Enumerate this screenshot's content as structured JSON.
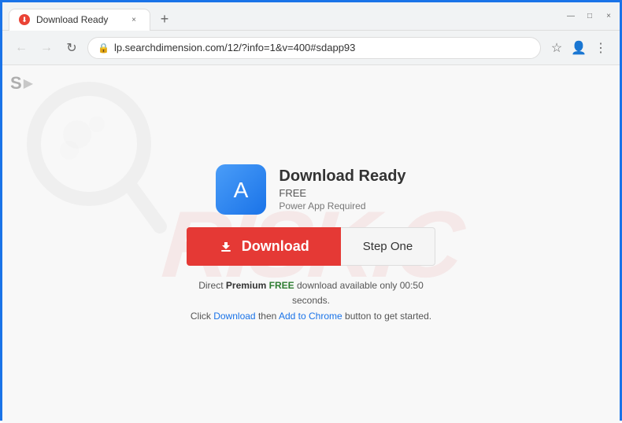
{
  "browser": {
    "tab": {
      "favicon": "🔴",
      "title": "Download Ready",
      "close_label": "×"
    },
    "new_tab_label": "+",
    "window_controls": {
      "minimize": "—",
      "maximize": "□",
      "close": "×"
    },
    "nav": {
      "back_label": "←",
      "forward_label": "→",
      "refresh_label": "↻"
    },
    "address_bar": {
      "lock_icon": "🔒",
      "url": "lp.searchdimension.com/12/?info=1&v=400#sdapp93"
    },
    "actions": {
      "bookmark_label": "☆",
      "account_label": "👤",
      "menu_label": "⋮"
    }
  },
  "page": {
    "logo": {
      "s": "S",
      "arrow": "▶"
    },
    "watermark": "RISK.C",
    "app": {
      "name": "Download Ready",
      "price": "FREE",
      "requirement": "Power App Required"
    },
    "buttons": {
      "download_label": "Download",
      "step_label": "Step One"
    },
    "info_line1": "Direct",
    "info_premium": "Premium",
    "info_free": "FREE",
    "info_line1_rest": "download available only 00:50 seconds.",
    "info_line2_pre": "Click",
    "info_download_link": "Download",
    "info_line2_mid": "then",
    "info_chrome_link": "Add to Chrome",
    "info_line2_end": "button to get started."
  }
}
